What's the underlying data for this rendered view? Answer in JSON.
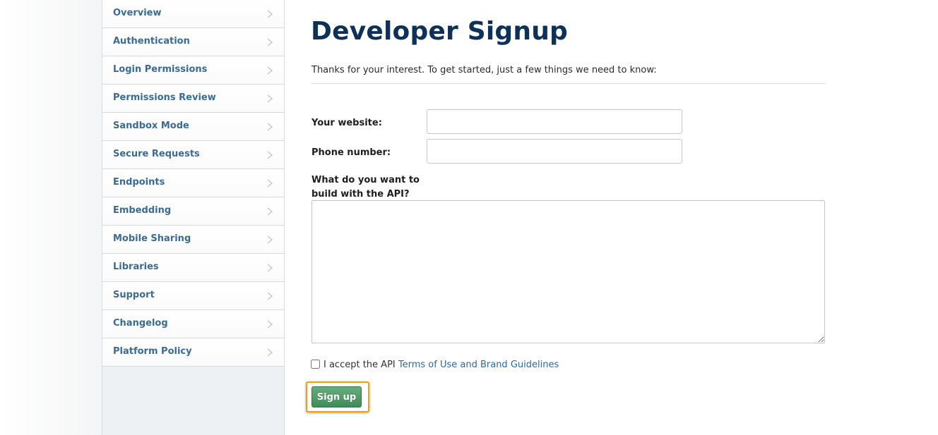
{
  "sidebar": {
    "items": [
      {
        "label": "Overview"
      },
      {
        "label": "Authentication"
      },
      {
        "label": "Login Permissions"
      },
      {
        "label": "Permissions Review"
      },
      {
        "label": "Sandbox Mode"
      },
      {
        "label": "Secure Requests"
      },
      {
        "label": "Endpoints"
      },
      {
        "label": "Embedding"
      },
      {
        "label": "Mobile Sharing"
      },
      {
        "label": "Libraries"
      },
      {
        "label": "Support"
      },
      {
        "label": "Changelog"
      },
      {
        "label": "Platform Policy"
      }
    ],
    "chevron_icon": "chevron-right-icon"
  },
  "main": {
    "title": "Developer Signup",
    "intro": "Thanks for your interest. To get started, just a few things we need to know:",
    "form": {
      "website_label": "Your website:",
      "website_value": "",
      "phone_label": "Phone number:",
      "phone_value": "",
      "build_label_line1": "What do you want to",
      "build_label_line2": "build with the API?",
      "build_value": "",
      "terms_prefix": "I accept the API ",
      "terms_link": "Terms of Use and Brand Guidelines",
      "terms_checked": false,
      "submit_label": "Sign up"
    }
  },
  "colors": {
    "title": "#0e3159",
    "nav_link": "#3b6a93",
    "link": "#2f6a9b",
    "button": "#4a955f",
    "focus_ring": "#f0a30a",
    "sidebar_bg": "#eef1f4"
  }
}
